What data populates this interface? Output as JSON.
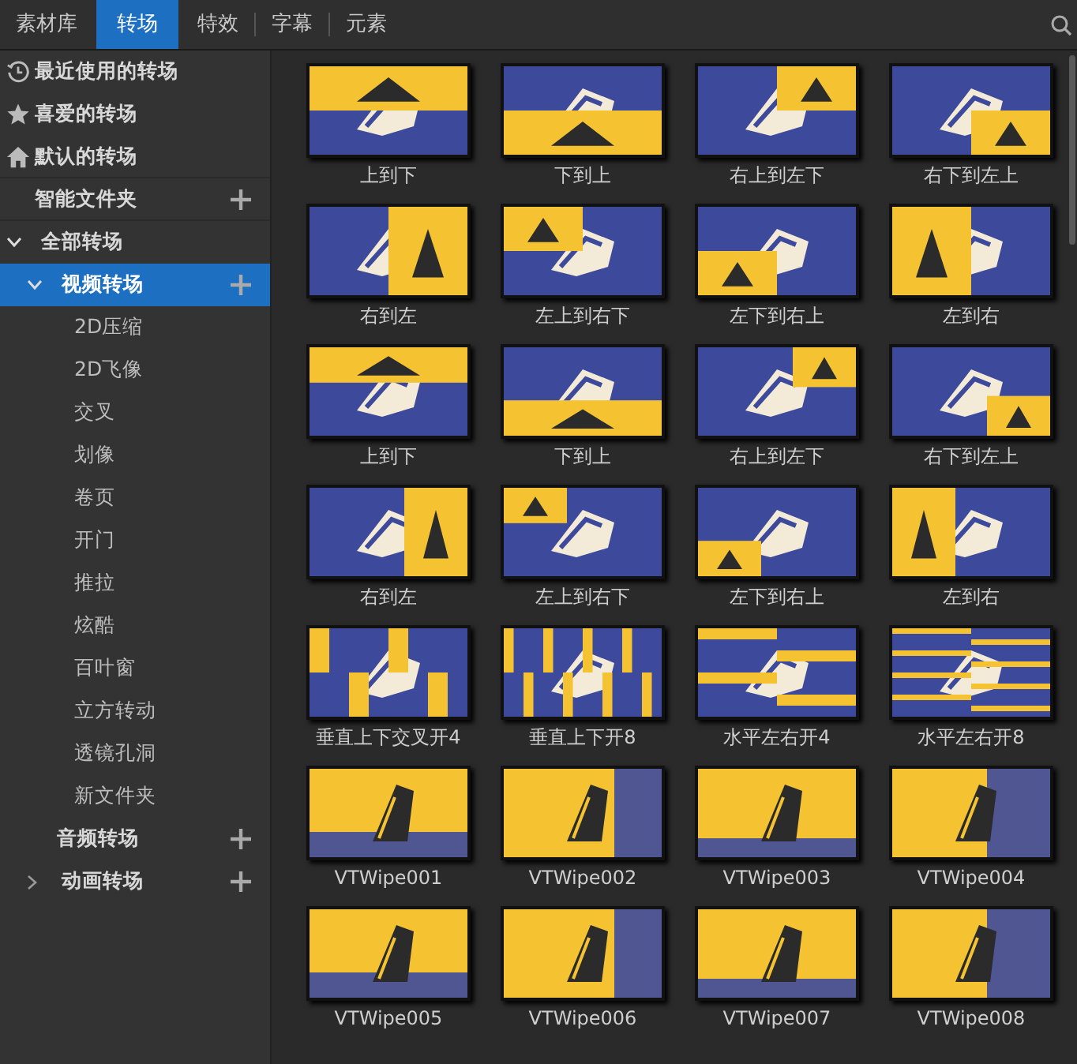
{
  "tabs": [
    {
      "label": "素材库",
      "selected": false
    },
    {
      "label": "转场",
      "selected": true
    },
    {
      "label": "特效",
      "selected": false
    },
    {
      "label": "字幕",
      "selected": false
    },
    {
      "label": "元素",
      "selected": false
    }
  ],
  "sidebar": {
    "items": [
      {
        "label": "最近使用的转场",
        "kind": "recent"
      },
      {
        "label": "喜爱的转场",
        "kind": "favorite"
      },
      {
        "label": "默认的转场",
        "kind": "default"
      },
      {
        "label": "智能文件夹",
        "kind": "folder",
        "addable": true
      },
      {
        "label": "全部转场",
        "kind": "group",
        "expanded": true,
        "children": [
          {
            "label": "视频转场",
            "kind": "group",
            "expanded": true,
            "selected": true,
            "addable": true,
            "children": [
              {
                "label": "2D压缩",
                "selected": false
              },
              {
                "label": "2D飞像",
                "selected": false
              },
              {
                "label": "交叉",
                "selected": false
              },
              {
                "label": "划像",
                "selected": false
              },
              {
                "label": "卷页",
                "selected": false
              },
              {
                "label": "开门",
                "selected": false
              },
              {
                "label": "推拉",
                "selected": false
              },
              {
                "label": "炫酷",
                "selected": false
              },
              {
                "label": "百叶窗",
                "selected": false
              },
              {
                "label": "立方转动",
                "selected": false
              },
              {
                "label": "透镜孔洞",
                "selected": false
              },
              {
                "label": "新文件夹",
                "selected": false
              }
            ]
          },
          {
            "label": "音频转场",
            "kind": "leaf",
            "selected": false,
            "addable": true
          },
          {
            "label": "动画转场",
            "kind": "group",
            "expanded": false,
            "selected": false,
            "addable": true
          }
        ]
      }
    ]
  },
  "transitions": [
    {
      "label": "上到下"
    },
    {
      "label": "下到上"
    },
    {
      "label": "右上到左下"
    },
    {
      "label": "右下到左上"
    },
    {
      "label": "右到左"
    },
    {
      "label": "左上到右下"
    },
    {
      "label": "左下到右上"
    },
    {
      "label": "左到右"
    },
    {
      "label": "上到下"
    },
    {
      "label": "下到上"
    },
    {
      "label": "右上到左下"
    },
    {
      "label": "右下到左上"
    },
    {
      "label": "右到左"
    },
    {
      "label": "左上到右下"
    },
    {
      "label": "左下到右上"
    },
    {
      "label": "左到右"
    },
    {
      "label": "垂直上下交叉开4"
    },
    {
      "label": "垂直上下开8"
    },
    {
      "label": "水平左右开4"
    },
    {
      "label": "水平左右开8"
    },
    {
      "label": "VTWipe001"
    },
    {
      "label": "VTWipe002"
    },
    {
      "label": "VTWipe003"
    },
    {
      "label": "VTWipe004"
    },
    {
      "label": "VTWipe005"
    },
    {
      "label": "VTWipe006"
    },
    {
      "label": "VTWipe007"
    },
    {
      "label": "VTWipe008"
    }
  ]
}
